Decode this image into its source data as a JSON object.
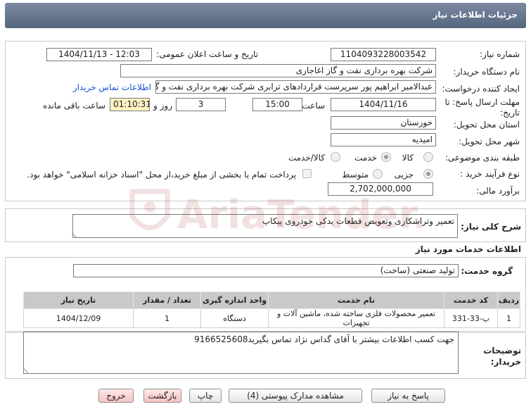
{
  "header": {
    "title": "جزئیات اطلاعات نیاز"
  },
  "labels": {
    "need_number": "شماره نیاز:",
    "announce_datetime": "تاریخ و ساعت اعلان عمومی:",
    "buyer_org": "نام دستگاه خریدار:",
    "requester": "ایجاد کننده درخواست:",
    "buyer_contact_link": "اطلاعات تماس خریدار",
    "deadline": "مهلت ارسال پاسخ: تا تاریخ:",
    "time_word": "ساعت",
    "days_and": "روز و",
    "remaining": "ساعت باقی مانده",
    "province": "استان محل تحویل:",
    "city": "شهر محل تحویل:",
    "category": "طبقه بندی موضوعی:",
    "process_type": "نوع فرآیند خرید :",
    "budget": "برآورد مالی:",
    "description_title": "شرح کلی نیاز:",
    "services_info": "اطلاعات خدمات مورد نیاز",
    "service_group": "گروه خدمت:",
    "buyer_notes": "توضیحات خریدار:"
  },
  "values": {
    "need_number": "1104093228003542",
    "announce_datetime": "1404/11/13 - 12:03",
    "buyer_org": "شرکت بهره برداری نفت و گاز اغاجاری",
    "requester": "عبدالامیر ابراهیم پور سرپرست قراردادهای ترابری شرکت بهره برداری نفت و گاز",
    "deadline_date": "1404/11/16",
    "deadline_time": "15:00",
    "days_left": "3",
    "time_left": "01:10:31",
    "province": "خوزستان",
    "city": "امیدیه",
    "budget": "2,702,000,000",
    "description": "تعمیر وتراشکاری وتعویض قطعات یدکی خودروی پیکاپ",
    "service_group": "تولید صنعتی (ساخت)",
    "buyer_notes": "جهت کسب اطلاعات بیشتر با آقای گداس نژاد تماس بگیرید9166525608"
  },
  "category_options": [
    {
      "label": "کالا",
      "selected": false
    },
    {
      "label": "خدمت",
      "selected": true
    },
    {
      "label": "کالا/خدمت",
      "selected": false
    }
  ],
  "process_options": [
    {
      "label": "جزیی",
      "selected": true
    },
    {
      "label": "متوسط",
      "selected": false
    }
  ],
  "payment_note": "پرداخت تمام یا بخشی از مبلغ خرید،از محل \"اسناد خزانه اسلامی\" خواهد بود.",
  "table": {
    "headers": [
      "ردیف",
      "کد خدمت",
      "نام خدمت",
      "واحد اندازه گیری",
      "تعداد / مقدار",
      "تاریخ نیاز"
    ],
    "rows": [
      [
        "1",
        "پ-33-331",
        "تعمیر محصولات فلزی ساخته شده، ماشین آلات و تجهیزات",
        "دستگاه",
        "1",
        "1404/12/09"
      ]
    ]
  },
  "buttons": {
    "reply": "پاسخ به نیاز",
    "view_docs": "مشاهده مدارک پیوستی (4)",
    "print": "چاپ",
    "back": "بازگشت",
    "exit": "خروج"
  },
  "watermark": {
    "text": "AriaTender.neT"
  },
  "colors": {
    "header": "#5f6f88",
    "link": "#1a4fd0",
    "timer_bg": "#fff3c4",
    "table_header": "#c9c9c9"
  }
}
